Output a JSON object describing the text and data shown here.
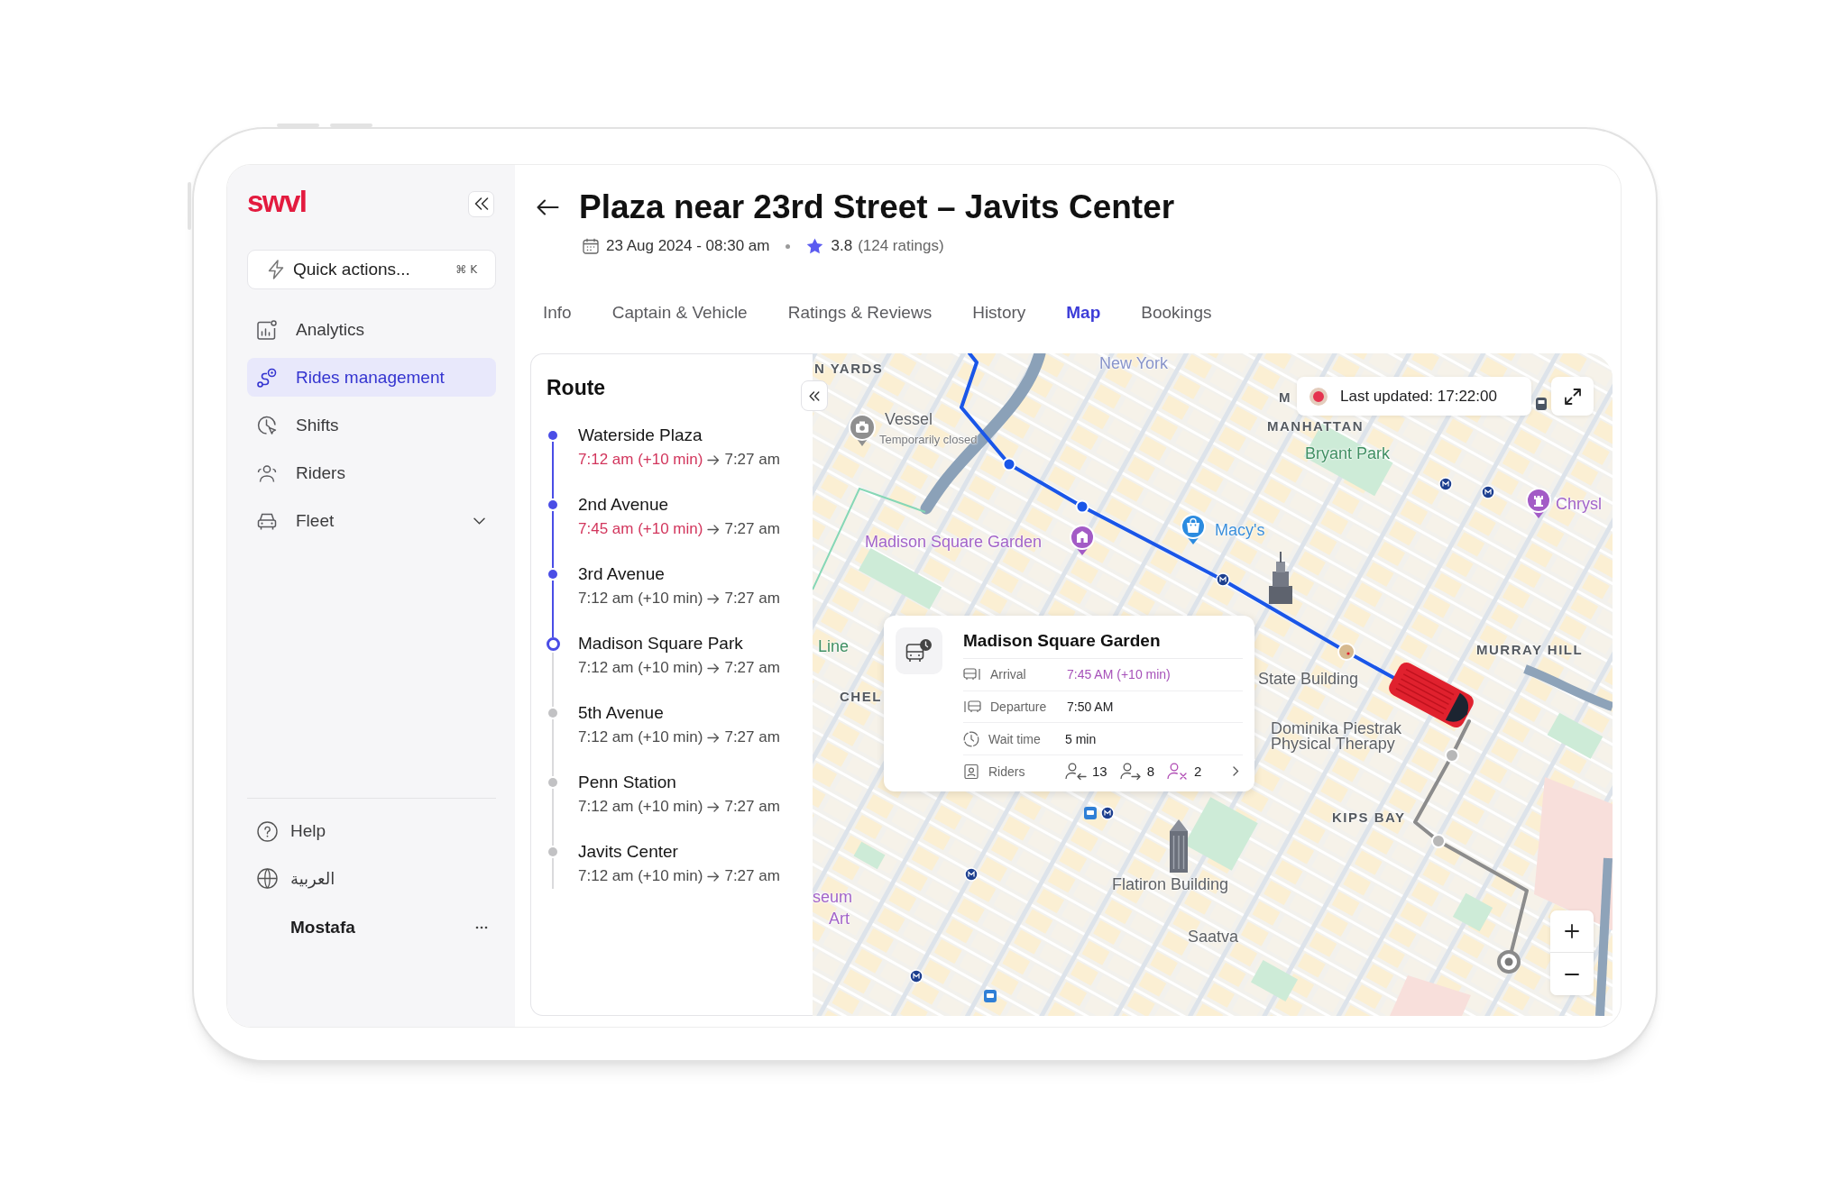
{
  "sidebar": {
    "logo": "swvl",
    "quick_actions": {
      "label": "Quick actions...",
      "shortcut": "⌘ K"
    },
    "nav": [
      {
        "label": "Analytics",
        "selected": false
      },
      {
        "label": "Rides management",
        "selected": true
      },
      {
        "label": "Shifts",
        "selected": false
      },
      {
        "label": "Riders",
        "selected": false
      },
      {
        "label": "Fleet",
        "selected": false,
        "expanded": false
      }
    ],
    "footer": [
      {
        "label": "Help"
      },
      {
        "label": "العربية"
      }
    ],
    "user": {
      "name": "Mostafa"
    }
  },
  "header": {
    "title": "Plaza near 23rd Street – Javits Center",
    "date": "23 Aug 2024 - 08:30 am",
    "rating": "3.8",
    "ratings_count": "(124 ratings)"
  },
  "tabs": [
    {
      "label": "Info",
      "selected": false
    },
    {
      "label": "Captain & Vehicle",
      "selected": false
    },
    {
      "label": "Ratings & Reviews",
      "selected": false
    },
    {
      "label": "History",
      "selected": false
    },
    {
      "label": "Map",
      "selected": true
    },
    {
      "label": "Bookings",
      "selected": false
    }
  ],
  "route": {
    "title": "Route",
    "stops": [
      {
        "name": "Waterside Plaza",
        "scheduled": "7:12 am (+10 min)",
        "delayed": true,
        "actual": "7:27 am",
        "passed": true,
        "current": false
      },
      {
        "name": "2nd Avenue",
        "scheduled": "7:45 am (+10 min)",
        "delayed": true,
        "actual": "7:27 am",
        "passed": true,
        "current": false
      },
      {
        "name": "3rd Avenue",
        "scheduled": "7:12 am (+10 min)",
        "delayed": false,
        "actual": "7:27 am",
        "passed": true,
        "current": false
      },
      {
        "name": "Madison Square Park",
        "scheduled": "7:12 am (+10 min)",
        "delayed": false,
        "actual": "7:27 am",
        "passed": false,
        "current": true
      },
      {
        "name": "5th Avenue",
        "scheduled": "7:12 am (+10 min)",
        "delayed": false,
        "actual": "7:27 am",
        "passed": false,
        "current": false
      },
      {
        "name": "Penn Station",
        "scheduled": "7:12 am (+10 min)",
        "delayed": false,
        "actual": "7:27 am",
        "passed": false,
        "current": false
      },
      {
        "name": "Javits Center",
        "scheduled": "7:12 am (+10 min)",
        "delayed": false,
        "actual": "7:27 am",
        "passed": false,
        "current": false
      }
    ]
  },
  "map": {
    "labels": [
      {
        "text": "N YARDS",
        "kind": "district"
      },
      {
        "text": "New York",
        "kind": "city"
      },
      {
        "text": "Vessel",
        "kind": "place"
      },
      {
        "text": "Temporarily closed",
        "kind": "note"
      },
      {
        "text": "M",
        "kind": "district"
      },
      {
        "text": "MANHATTAN",
        "kind": "district"
      },
      {
        "text": "Bryant Park",
        "kind": "park"
      },
      {
        "text": "Chrysl",
        "kind": "venue"
      },
      {
        "text": "Macy's",
        "kind": "shop"
      },
      {
        "text": "Madison Square Garden",
        "kind": "venue"
      },
      {
        "text": "State Building",
        "kind": "place"
      },
      {
        "text": "Line",
        "kind": "park"
      },
      {
        "text": "CHEL",
        "kind": "district"
      },
      {
        "text": "MURRAY HILL",
        "kind": "district"
      },
      {
        "text": "Dominika Piestrak Physical Therapy",
        "kind": "place"
      },
      {
        "text": "KIPS BAY",
        "kind": "district"
      },
      {
        "text": "Flatiron Building",
        "kind": "place"
      },
      {
        "text": "seum",
        "kind": "venue"
      },
      {
        "text": "Art",
        "kind": "venue"
      },
      {
        "text": "Saatva",
        "kind": "place"
      }
    ],
    "status": {
      "text": "Last updated: 17:22:00",
      "live": true
    },
    "popup": {
      "title": "Madison Square Garden",
      "rows": [
        {
          "label": "Arrival",
          "value": "7:45 AM (+10 min)",
          "delayed": true
        },
        {
          "label": "Departure",
          "value": "7:50 AM",
          "delayed": false
        },
        {
          "label": "Wait time",
          "value": "5 min",
          "delayed": false
        }
      ],
      "riders": {
        "label": "Riders",
        "counts": [
          {
            "value": "13",
            "kind": "pickup"
          },
          {
            "value": "8",
            "kind": "dropoff"
          },
          {
            "value": "2",
            "kind": "no_show"
          }
        ]
      }
    }
  }
}
